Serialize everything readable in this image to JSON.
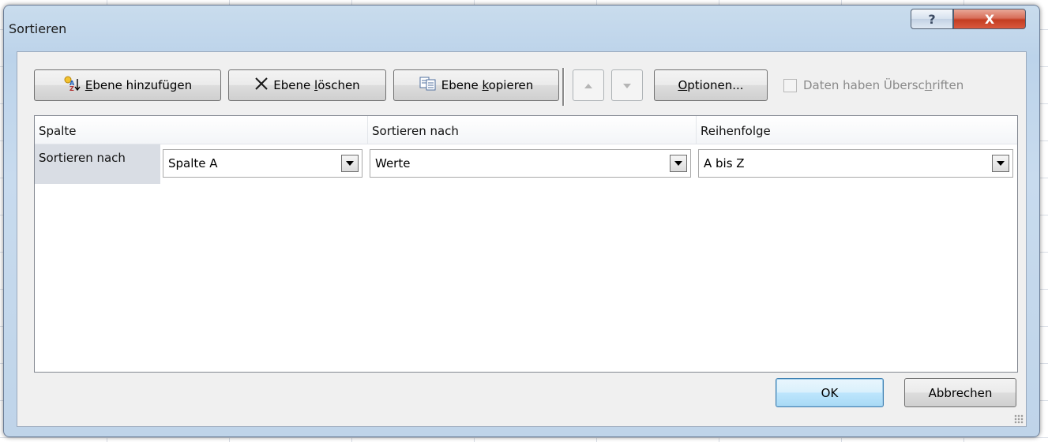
{
  "window": {
    "title": "Sortieren",
    "help_glyph": "?",
    "close_glyph": "X"
  },
  "toolbar": {
    "add_level": {
      "pre": "",
      "accel": "E",
      "post": "bene hinzufügen",
      "icon": "add-level-icon"
    },
    "delete_level": {
      "pre": "Ebene ",
      "accel": "l",
      "post": "öschen",
      "icon": "x-delete-icon"
    },
    "copy_level": {
      "pre": "Ebene ",
      "accel": "k",
      "post": "opieren",
      "icon": "copy-icon"
    },
    "move_up_icon": "triangle-up-icon",
    "move_down_icon": "triangle-down-icon",
    "options": {
      "pre": "",
      "accel": "O",
      "post": "ptionen...",
      "label": "Optionen..."
    },
    "headers_checkbox": {
      "pre": "Daten haben Übersc",
      "accel": "h",
      "post": "riften",
      "checked": false
    }
  },
  "grid": {
    "headers": [
      "Spalte",
      "Sortieren nach",
      "Reihenfolge"
    ],
    "rows": [
      {
        "label": "Sortieren nach",
        "column": "Spalte A",
        "sort_on": "Werte",
        "order": "A bis Z"
      }
    ]
  },
  "footer": {
    "ok": "OK",
    "cancel": "Abbrechen"
  },
  "colors": {
    "frame": "#bfd4e9",
    "close": "#c43d22",
    "ok_border": "#3c7fb1",
    "disabled_text": "#8a8a8a"
  }
}
